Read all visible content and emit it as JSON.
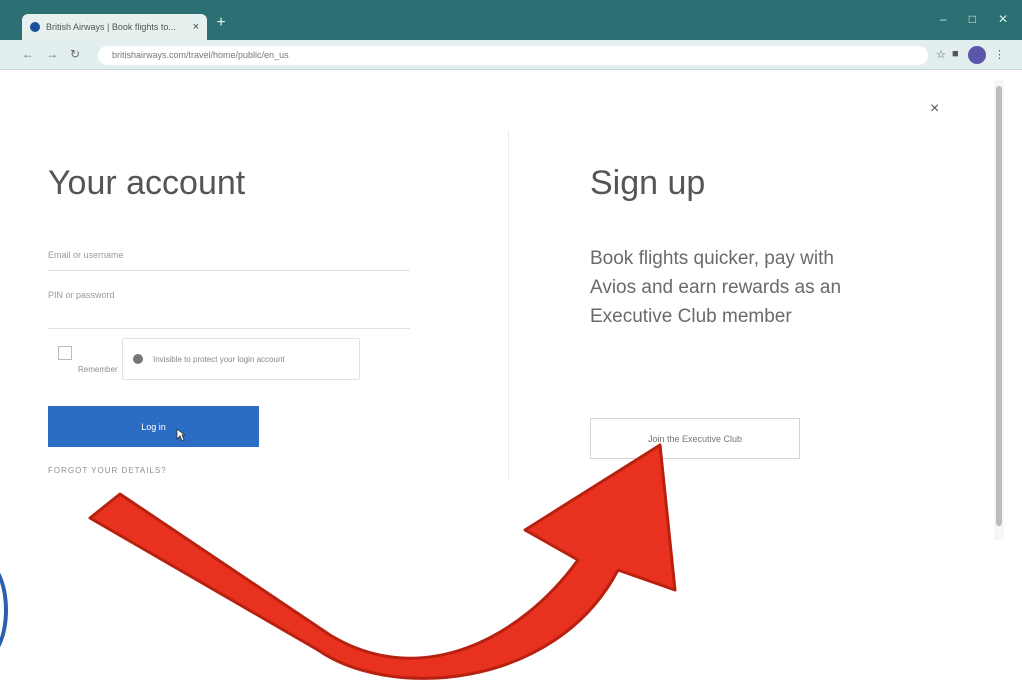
{
  "browser": {
    "tab_title": "British Airways | Book flights to...",
    "tab_close": "×",
    "new_tab": "+",
    "url": "britishairways.com/travel/home/public/en_us",
    "win_controls": [
      "–",
      "□",
      "✕"
    ]
  },
  "modal": {
    "close_label": "×"
  },
  "account": {
    "title": "Your account",
    "email_placeholder": "Email or username",
    "password_label": "PIN or password",
    "remember_label": "Remember",
    "recaptcha_text": "Invisible to protect your login account",
    "login_button": "Log in",
    "forgot_link": "Forgot your details?"
  },
  "signup": {
    "title": "Sign up",
    "description": "Book flights quicker, pay with Avios and earn rewards as an Executive Club member",
    "join_button": "Join the Executive Club"
  },
  "colors": {
    "titlebar": "#2b6f73",
    "primary_button": "#2b6cc4",
    "annotation_arrow": "#e8311e"
  }
}
